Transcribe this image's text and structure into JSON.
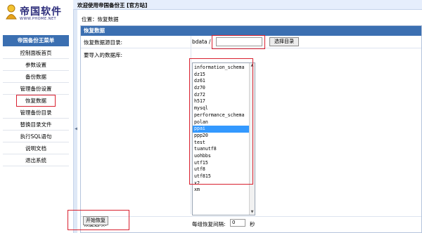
{
  "app": {
    "logo_text": "帝国软件",
    "logo_url": "WWW.PHOME.NET",
    "header_title": "欢迎使用帝国备份王 [官方站]"
  },
  "sidebar": {
    "title": "帝国备份王菜单",
    "items": [
      {
        "label": "控制面板首页"
      },
      {
        "label": "参数设置"
      },
      {
        "label": "备份数据"
      },
      {
        "label": "管理备份设置"
      },
      {
        "label": "恢复数据"
      },
      {
        "label": "管理备份目录"
      },
      {
        "label": "替换目录文件"
      },
      {
        "label": "执行SQL语句"
      },
      {
        "label": "说明文档"
      },
      {
        "label": "退出系统"
      }
    ],
    "active_index": 4
  },
  "main": {
    "breadcrumb": "位置：恢复数据",
    "panel_title": "恢复数据",
    "source_dir_label": "恢复数据源目录:",
    "source_dir_prefix": "bdata /",
    "source_dir_value": "",
    "choose_dir_button": "选择目录",
    "db_label": "要导入的数据库:",
    "databases": [
      "information_schema",
      "dz15",
      "dz61",
      "dz70",
      "dz72",
      "h517",
      "mysql",
      "performance_schema",
      "polan",
      "ppai",
      "ppp20",
      "test",
      "tuanutf8",
      "uohbbs",
      "utf15",
      "utf8",
      "utf815",
      "x2",
      "xm"
    ],
    "selected_database": "ppai",
    "options_label": "恢复选项:",
    "interval_label": "每组恢复间隔:",
    "interval_value": "0",
    "interval_unit": "秒",
    "start_button": "开始恢复"
  },
  "colors": {
    "accent": "#3b6fb1",
    "highlight": "#d9202f",
    "selection": "#3399ff"
  }
}
